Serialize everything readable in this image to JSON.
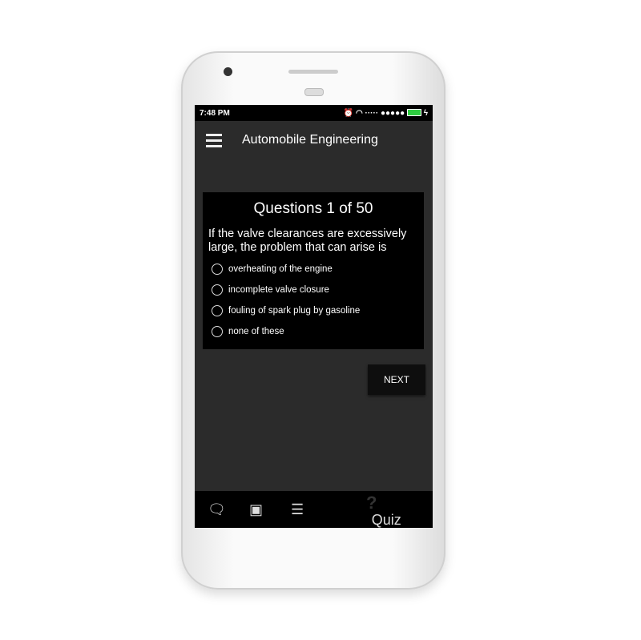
{
  "status": {
    "time": "7:48 PM",
    "battery_color": "#2ecc40"
  },
  "appbar": {
    "title": "Automobile Engineering"
  },
  "quiz": {
    "heading": "Questions 1 of 50",
    "question": "If the valve clearances are excessively large, the problem that can arise is",
    "options": [
      "overheating of the engine",
      "incomplete valve closure",
      "fouling of spark plug by gasoline",
      "none of these"
    ],
    "next_label": "NEXT"
  },
  "nav": {
    "quiz_label": "Quiz",
    "quiz_glyph": "?"
  }
}
